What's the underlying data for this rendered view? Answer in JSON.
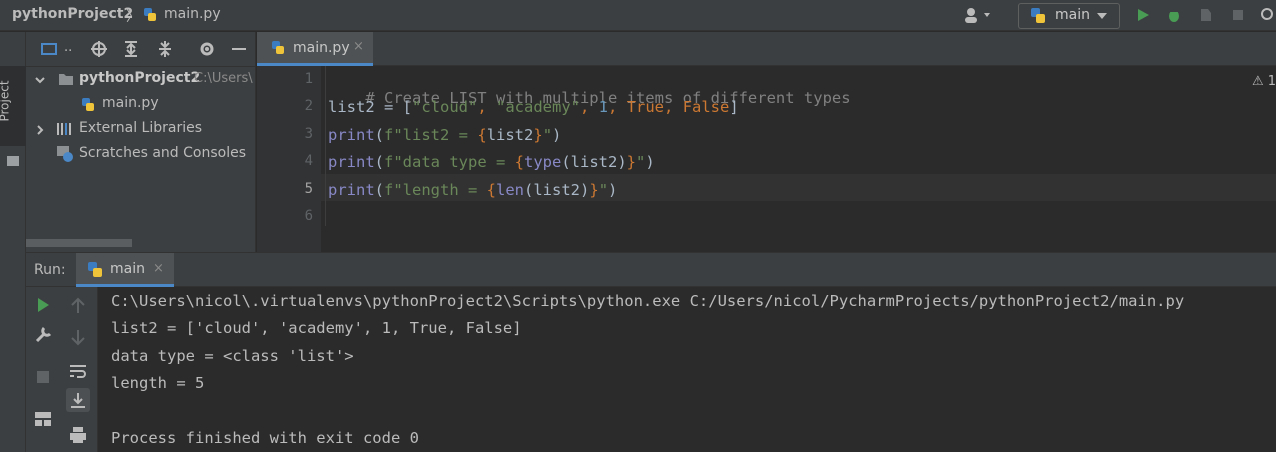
{
  "navbar": {
    "project": "pythonProject2",
    "separator": "〉",
    "file": "main.py",
    "run_config": "main"
  },
  "left_stripe": {
    "project_tab": "Project"
  },
  "project_tree": {
    "root_name": "pythonProject2",
    "root_path": "C:\\Users\\",
    "file": "main.py",
    "external": "External Libraries",
    "scratches": "Scratches and Consoles"
  },
  "editor": {
    "tab_label": "main.py",
    "tab_close": "×",
    "warning": "⚠ 1",
    "line_numbers": [
      "1",
      "2",
      "3",
      "4",
      "5",
      "6"
    ],
    "code": {
      "l1": "# Create LIST with multiple items of different types",
      "l2_a": "list2 = [",
      "l2_s1": "\"cloud\"",
      "l2_c1": ", ",
      "l2_s2": "\"academy\"",
      "l2_c2": ", ",
      "l2_n": "1",
      "l2_c3": ", ",
      "l2_t": "True",
      "l2_c4": ", ",
      "l2_f": "False",
      "l2_end": "]",
      "print": "print",
      "l3_f": "f\"list2 = ",
      "l3_var": "list2",
      "l4_f": "f\"data type = ",
      "l4_type": "type",
      "l4_var": "(list2)",
      "l5_f": "f\"length = ",
      "l5_len": "len",
      "l5_var": "(list2)"
    }
  },
  "run": {
    "label": "Run:",
    "tab": "main",
    "tab_close": "×",
    "output": [
      "C:\\Users\\nicol\\.virtualenvs\\pythonProject2\\Scripts\\python.exe C:/Users/nicol/PycharmProjects/pythonProject2/main.py",
      "list2 = ['cloud', 'academy', 1, True, False]",
      "data type = <class 'list'>",
      "length = 5",
      "",
      "Process finished with exit code 0"
    ]
  }
}
